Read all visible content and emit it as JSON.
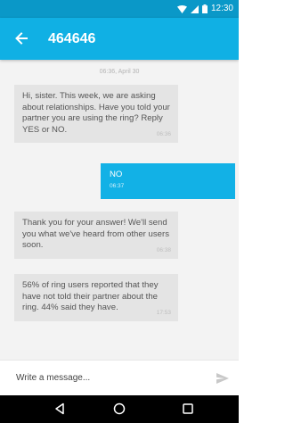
{
  "status_bar": {
    "time": "12:30",
    "icons": [
      "wifi-icon",
      "signal-icon",
      "battery-icon"
    ]
  },
  "app_bar": {
    "title": "464646",
    "back_icon": "arrow-left-icon"
  },
  "conversation": {
    "date_stamp": "06:36, April 30",
    "messages": [
      {
        "direction": "incoming",
        "text": "Hi, sister. This week, we are asking about relationships. Have you told your partner you are using the ring? Reply YES or NO.",
        "time": "06:36"
      },
      {
        "direction": "outgoing",
        "text": "NO",
        "time": "06:37"
      },
      {
        "direction": "incoming",
        "text": "Thank you for your answer! We'll send you what we've heard from other users soon.",
        "time": "06:38"
      },
      {
        "direction": "incoming",
        "text": "56% of ring users reported that they have not told their partner about the ring. 44% said they have.",
        "time": "17:53"
      }
    ]
  },
  "composer": {
    "placeholder": "Write a message...",
    "value": "",
    "send_icon": "send-icon"
  },
  "nav_bar": {
    "icons": [
      "back-triangle-icon",
      "home-circle-icon",
      "recents-square-icon"
    ]
  },
  "colors": {
    "status_bar": "#0a98c8",
    "app_bar": "#10b0e4",
    "outgoing_bubble": "#12b1e6",
    "incoming_bubble": "#e4e4e4",
    "background": "#f3f3f3"
  }
}
